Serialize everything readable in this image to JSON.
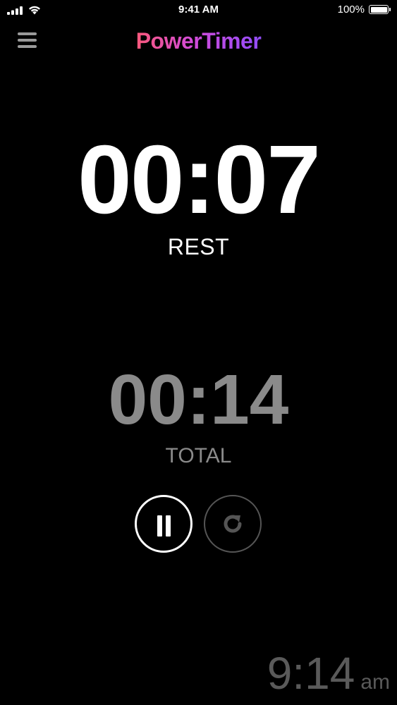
{
  "status_bar": {
    "time": "9:41 AM",
    "battery": "100%",
    "signal_icon": "signal-bars-icon",
    "wifi_icon": "wifi-icon",
    "battery_icon": "battery-icon"
  },
  "header": {
    "title": "PowerTimer",
    "menu_icon": "hamburger-menu-icon",
    "title_gradient": [
      "#ff5a6e",
      "#d34bd8",
      "#8a4dff"
    ]
  },
  "timer": {
    "current": "00:07",
    "phase": "REST",
    "total": "00:14",
    "total_label": "TOTAL"
  },
  "controls": {
    "pause_icon": "pause-icon",
    "reset_icon": "reset-icon"
  },
  "clock": {
    "time": "9:14",
    "ampm": "am"
  },
  "colors": {
    "background": "#000000",
    "primary_text": "#ffffff",
    "secondary_text": "#8a8a8a",
    "clock_text": "#5a5a5a"
  }
}
